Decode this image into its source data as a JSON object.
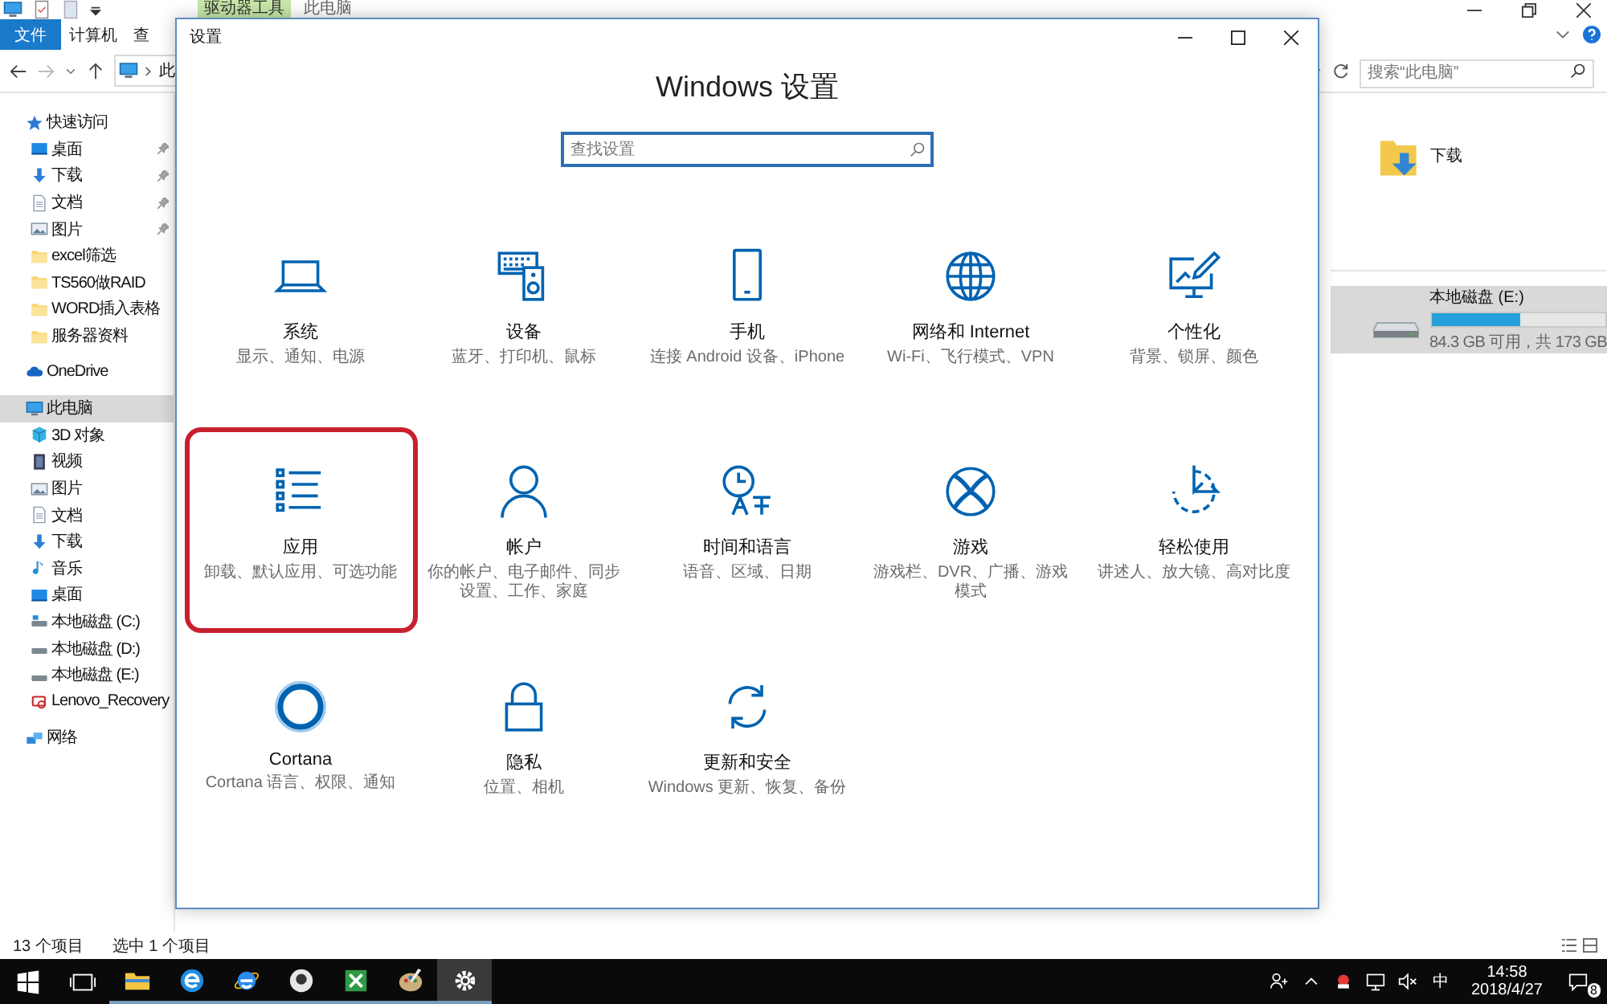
{
  "explorer": {
    "tool_tab": "驱动器工具",
    "title": "此电脑",
    "ribbon_tabs": [
      {
        "label": "文件",
        "selected": true
      },
      {
        "label": "计算机",
        "selected": false
      },
      {
        "label": "查",
        "selected": false
      }
    ],
    "address": "此",
    "search": {
      "placeholder": "搜索“此电脑”"
    },
    "sidebar": [
      {
        "label": "快速访问",
        "kind": "star",
        "selected": false,
        "children": [
          {
            "label": "桌面",
            "kind": "desktop",
            "selected": false,
            "pinned": true
          },
          {
            "label": "下载",
            "kind": "download",
            "selected": false,
            "pinned": true
          },
          {
            "label": "文档",
            "kind": "doc",
            "selected": false,
            "pinned": true
          },
          {
            "label": "图片",
            "kind": "picture",
            "selected": false,
            "pinned": true
          },
          {
            "label": "excel筛选",
            "kind": "folder",
            "selected": false,
            "pinned": false
          },
          {
            "label": "TS560做RAID",
            "kind": "folder",
            "selected": false,
            "pinned": false
          },
          {
            "label": "WORD插入表格",
            "kind": "folder",
            "selected": false,
            "pinned": false
          },
          {
            "label": "服务器资料",
            "kind": "folder",
            "selected": false,
            "pinned": false
          }
        ]
      },
      {
        "label": "OneDrive",
        "kind": "cloud",
        "selected": false
      },
      {
        "label": "此电脑",
        "kind": "pc",
        "selected": true,
        "children": [
          {
            "label": "3D 对象",
            "kind": "cube",
            "selected": false
          },
          {
            "label": "视频",
            "kind": "video",
            "selected": false
          },
          {
            "label": "图片",
            "kind": "picture",
            "selected": false
          },
          {
            "label": "文档",
            "kind": "doc",
            "selected": false
          },
          {
            "label": "下载",
            "kind": "download",
            "selected": false
          },
          {
            "label": "音乐",
            "kind": "music",
            "selected": false
          },
          {
            "label": "桌面",
            "kind": "desktop",
            "selected": false
          },
          {
            "label": "本地磁盘 (C:)",
            "kind": "osdrive",
            "selected": false
          },
          {
            "label": "本地磁盘 (D:)",
            "kind": "drive",
            "selected": false
          },
          {
            "label": "本地磁盘 (E:)",
            "kind": "drive",
            "selected": false
          },
          {
            "label": "Lenovo_Recovery",
            "kind": "recovery",
            "selected": false
          }
        ]
      },
      {
        "label": "网络",
        "kind": "network",
        "selected": false
      }
    ],
    "folders": [
      {
        "label": "下载"
      }
    ],
    "drives": [
      {
        "name": "本地磁盘 (E:)",
        "level": 0.51,
        "space": "84.3 GB 可用，共 173 GB",
        "selected": true
      }
    ],
    "status_bar": {
      "count": "13 个项目",
      "selection": "选中 1 个项目"
    }
  },
  "settings": {
    "title": "设置",
    "heading": "Windows 设置",
    "search": {
      "placeholder": "查找设置"
    },
    "tiles": [
      {
        "kind": "system",
        "title": "系统",
        "description": "显示、通知、电源",
        "highlighted": false
      },
      {
        "kind": "devices",
        "title": "设备",
        "description": "蓝牙、打印机、鼠标",
        "highlighted": false
      },
      {
        "kind": "phone",
        "title": "手机",
        "description": "连接 Android 设备、iPhone",
        "highlighted": false
      },
      {
        "kind": "network",
        "title": "网络和 Internet",
        "description": "Wi-Fi、飞行模式、VPN",
        "highlighted": false
      },
      {
        "kind": "personalization",
        "title": "个性化",
        "description": "背景、锁屏、颜色",
        "highlighted": false
      },
      {
        "kind": "apps",
        "title": "应用",
        "description": "卸载、默认应用、可选功能",
        "highlighted": true
      },
      {
        "kind": "accounts",
        "title": "帐户",
        "description": "你的帐户、电子邮件、同步设置、工作、家庭",
        "highlighted": false
      },
      {
        "kind": "time",
        "title": "时间和语言",
        "description": "语音、区域、日期",
        "highlighted": false
      },
      {
        "kind": "gaming",
        "title": "游戏",
        "description": "游戏栏、DVR、广播、游戏模式",
        "highlighted": false
      },
      {
        "kind": "ease",
        "title": "轻松使用",
        "description": "讲述人、放大镜、高对比度",
        "highlighted": false
      },
      {
        "kind": "cortana",
        "title": "Cortana",
        "description": "Cortana 语言、权限、通知",
        "highlighted": false
      },
      {
        "kind": "privacy",
        "title": "隐私",
        "description": "位置、相机",
        "highlighted": false
      },
      {
        "kind": "update",
        "title": "更新和安全",
        "description": "Windows 更新、恢复、备份",
        "highlighted": false
      }
    ]
  },
  "taskbar": {
    "apps": [
      {
        "kind": "taskview",
        "selected": false,
        "running": false
      },
      {
        "kind": "explorer",
        "selected": false,
        "running": true
      },
      {
        "kind": "edge",
        "selected": false,
        "running": true
      },
      {
        "kind": "ie",
        "selected": false,
        "running": true
      },
      {
        "kind": "app",
        "selected": false,
        "running": true
      },
      {
        "kind": "excel",
        "selected": false,
        "running": true
      },
      {
        "kind": "paint",
        "selected": false,
        "running": true
      },
      {
        "kind": "settings",
        "selected": true,
        "running": true
      }
    ],
    "input_method": "中",
    "time": "14:58",
    "date": "2018/4/27",
    "notifications": "8"
  }
}
